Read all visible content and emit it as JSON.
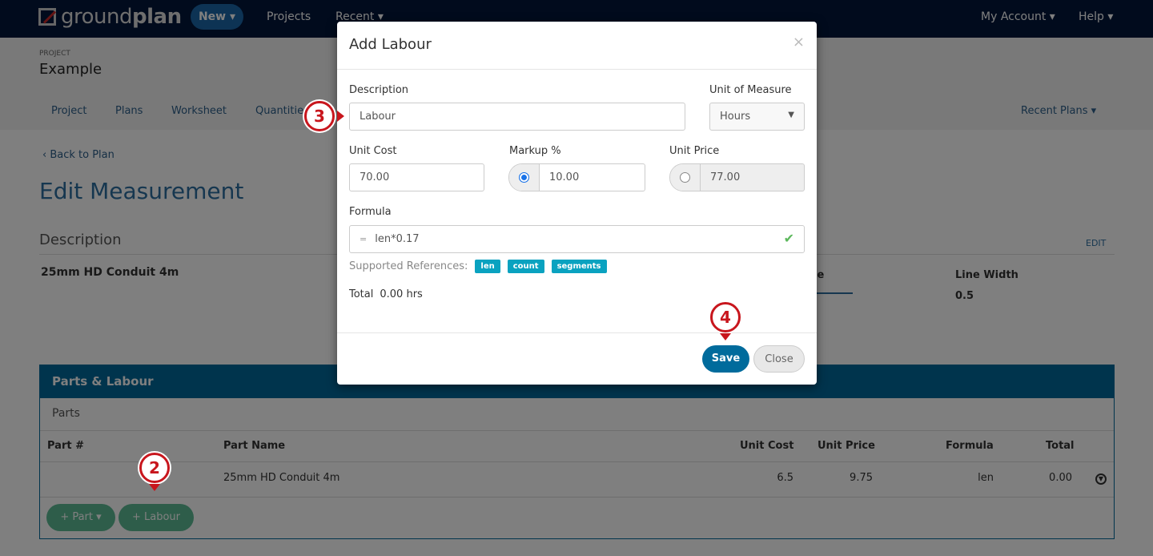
{
  "nav": {
    "logo_light": "ground",
    "logo_bold": "plan",
    "new": "New ▾",
    "projects": "Projects",
    "recent": "Recent ▾",
    "account": "My Account ▾",
    "help": "Help ▾"
  },
  "project": {
    "label": "PROJECT",
    "name": "Example"
  },
  "tabs": [
    "Project",
    "Plans",
    "Worksheet",
    "Quantities"
  ],
  "recent_plans": "Recent Plans ▾",
  "back": "Back to Plan",
  "page_title": "Edit Measurement",
  "description": {
    "heading": "Description",
    "edit": "EDIT",
    "value": "25mm HD Conduit 4m",
    "style_label": "le",
    "line_width_label": "Line Width",
    "line_width_value": "0.5"
  },
  "parts": {
    "title": "Parts & Labour",
    "subtitle": "Parts",
    "columns": [
      "Part #",
      "Part Name",
      "Unit Cost",
      "Unit Price",
      "Formula",
      "Total"
    ],
    "rows": [
      {
        "part_no": "",
        "name": "25mm HD Conduit 4m",
        "unit_cost": "6.5",
        "unit_price": "9.75",
        "formula": "len",
        "total": "0.00"
      }
    ],
    "add_part": "+ Part ▾",
    "add_labour": "+ Labour"
  },
  "modal": {
    "title": "Add Labour",
    "close_x": "×",
    "description_label": "Description",
    "description_value": "Labour",
    "uom_label": "Unit of Measure",
    "uom_value": "Hours",
    "unit_cost_label": "Unit Cost",
    "unit_cost_value": "70.00",
    "markup_label": "Markup %",
    "markup_value": "10.00",
    "unit_price_label": "Unit Price",
    "unit_price_value": "77.00",
    "formula_label": "Formula",
    "formula_prefix": "=",
    "formula_value": "len*0.17",
    "refs_label": "Supported References:",
    "refs": [
      "len",
      "count",
      "segments"
    ],
    "total_label": "Total",
    "total_value": "0.00 hrs",
    "save": "Save",
    "close": "Close"
  },
  "annotations": [
    "2",
    "3",
    "4"
  ],
  "colors": {
    "nav": "#03173a",
    "primary": "#00699a",
    "success": "#5dbb94",
    "tag": "#0aa2c0",
    "annotation": "#c8161d"
  }
}
